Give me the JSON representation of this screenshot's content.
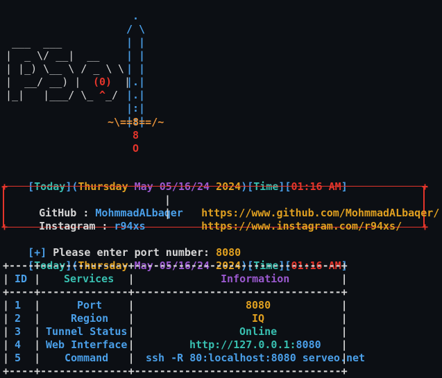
{
  "banner": {
    "ascii": "                               .\n                              / \\\n                              | |\n  ___   ___                   | |\n |  _ \\/ __|   __             | |\n | |_) \\__ \\ / _ \\            |.|\n |  __/ __) || (0) |          |.|\n |_|   |___/ \\_^_/            |:|\n                              |:|\n                         ~\\==8==/~\n                              8\n                              O",
    "accent_text": "(0)",
    "rocket_tail_1": "8",
    "rocket_tail_2": "O"
  },
  "status_line": {
    "open1": "[",
    "today": "Today",
    "close1": "]",
    "open2": "(",
    "day": "Thursday",
    "month": "May",
    "date": "05/16/24",
    "year": "2024",
    "close2": ")",
    "open3": "[",
    "time_label": "Time",
    "close3": "]",
    "open4": "[",
    "time": "01:16 AM",
    "close4": "]"
  },
  "links": {
    "github_label": "GitHub",
    "github_sep": " : ",
    "github_user": "MohmmadALbaqer",
    "github_url": "https://www.github.com/MohmmadALbaqer/",
    "instagram_label": "Instagram",
    "instagram_sep": " : ",
    "instagram_user": "r94xs",
    "instagram_url": "https://www.instagram.com/r94xs/"
  },
  "prompt": {
    "marker": "[+]",
    "text": " Please enter port number: ",
    "value": "8080"
  },
  "table": {
    "headers": [
      "ID",
      "Services",
      "Information"
    ],
    "rows": [
      {
        "id": "1",
        "service": "Port",
        "info": "8080"
      },
      {
        "id": "2",
        "service": "Region",
        "info": "IQ"
      },
      {
        "id": "3",
        "service": "Tunnel Status",
        "info": "Online"
      },
      {
        "id": "4",
        "service": "Web Interface",
        "info_a": "http://127.0.0.1:",
        "info_b": "8080"
      },
      {
        "id": "5",
        "service": "Command",
        "info": "ssh -R 80:localhost:8080 serveo.net"
      }
    ]
  },
  "colors": {
    "background": "#0c0f14",
    "blue": "#4a9fe8",
    "yellow": "#e0a020",
    "magenta": "#9b59d0",
    "red": "#e5352b",
    "orange": "#e8923a",
    "cyan": "#38bfb0"
  }
}
